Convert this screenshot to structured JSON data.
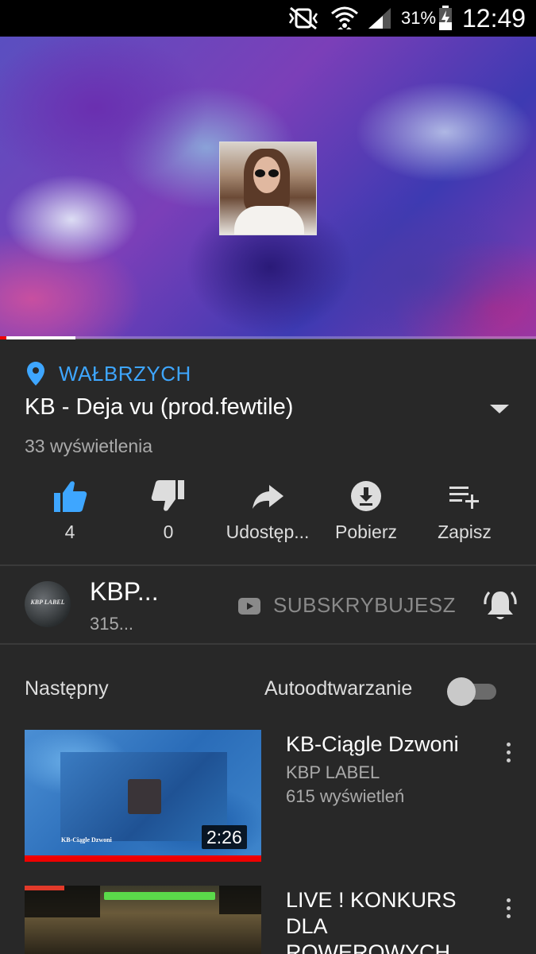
{
  "status_bar": {
    "battery_percent": "31%",
    "time": "12:49",
    "icons": [
      "mute-vibrate-icon",
      "wifi-icon",
      "signal-icon",
      "battery-charging-icon"
    ]
  },
  "player": {
    "progress_fraction": 0.14
  },
  "video": {
    "location": "WAŁBRZYCH",
    "title": "KB - Deja vu (prod.fewtile)",
    "views": "33 wyświetlenia"
  },
  "actions": {
    "like_count": "4",
    "dislike_count": "0",
    "share_label": "Udostęp...",
    "download_label": "Pobierz",
    "save_label": "Zapisz"
  },
  "channel": {
    "avatar_text": "KBP LABEL",
    "name": "KBP...",
    "subscribers": "315...",
    "subscribe_state": "SUBSKRYBUJESZ"
  },
  "up_next": {
    "label": "Następny",
    "autoplay_label": "Autoodtwarzanie",
    "autoplay_on": false,
    "items": [
      {
        "title": "KB-Ciągle Dzwoni",
        "channel": "KBP LABEL",
        "views": "615 wyświetleń",
        "duration": "2:26",
        "thumb_caption": "KB-Ciągle Dzwoni"
      },
      {
        "title": "LIVE ! KONKURS DLA ROWEROWYCH",
        "channel": "",
        "views": "",
        "duration": ""
      }
    ]
  },
  "colors": {
    "background": "#282828",
    "accent_blue": "#3ea6ff",
    "progress_red": "#ee0000"
  }
}
